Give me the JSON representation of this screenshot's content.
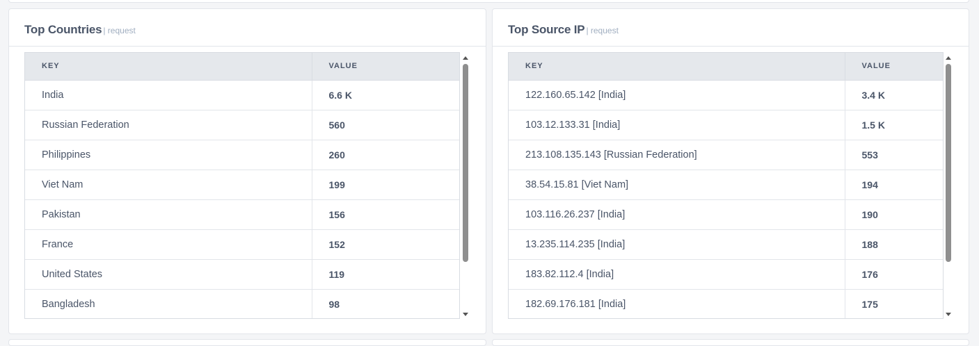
{
  "left_panel": {
    "title": "Top Countries",
    "subtitle": "| request",
    "columns": {
      "key": "KEY",
      "value": "VALUE"
    },
    "rows": [
      {
        "key": "India",
        "value": "6.6 K"
      },
      {
        "key": "Russian Federation",
        "value": "560"
      },
      {
        "key": "Philippines",
        "value": "260"
      },
      {
        "key": "Viet Nam",
        "value": "199"
      },
      {
        "key": "Pakistan",
        "value": "156"
      },
      {
        "key": "France",
        "value": "152"
      },
      {
        "key": "United States",
        "value": "119"
      },
      {
        "key": "Bangladesh",
        "value": "98"
      }
    ]
  },
  "right_panel": {
    "title": "Top Source IP",
    "subtitle": "| request",
    "columns": {
      "key": "KEY",
      "value": "VALUE"
    },
    "rows": [
      {
        "key": "122.160.65.142 [India]",
        "value": "3.4 K"
      },
      {
        "key": "103.12.133.31 [India]",
        "value": "1.5 K"
      },
      {
        "key": "213.108.135.143 [Russian Federation]",
        "value": "553"
      },
      {
        "key": "38.54.15.81 [Viet Nam]",
        "value": "194"
      },
      {
        "key": "103.116.26.237 [India]",
        "value": "190"
      },
      {
        "key": "13.235.114.235 [India]",
        "value": "188"
      },
      {
        "key": "183.82.112.4 [India]",
        "value": "176"
      },
      {
        "key": "182.69.176.181 [India]",
        "value": "175"
      }
    ]
  },
  "colors": {
    "header_bg": "#e5e8ec",
    "text": "#4a5568",
    "muted": "#a0aec0",
    "border": "#e2e5ea"
  }
}
